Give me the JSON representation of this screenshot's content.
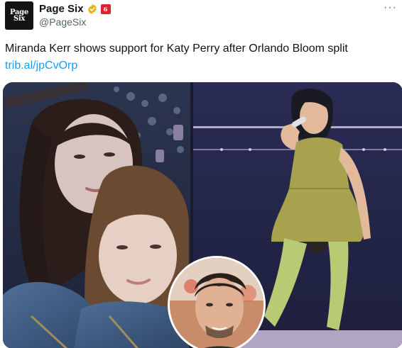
{
  "tweet": {
    "avatar_text_line1": "Page",
    "avatar_text_line2": "Six",
    "display_name": "Page Six",
    "verified_icon": "verified-badge-gold-icon",
    "affiliate_badge_text": "6",
    "handle": "@PageSix",
    "more_label": "···",
    "text": "Miranda Kerr shows support for Katy Perry after Orlando Bloom split",
    "link": "trib.al/jpCvOrp"
  },
  "media": {
    "left_photo": "selfie-two-women-concert-image",
    "right_photo": "performer-yellow-outfit-stage-image",
    "inset_photo": "man-portrait-circle-inset-image"
  },
  "colors": {
    "link": "#1d9bf0",
    "verified_gold": "#e2b719",
    "text_secondary": "#536471"
  }
}
